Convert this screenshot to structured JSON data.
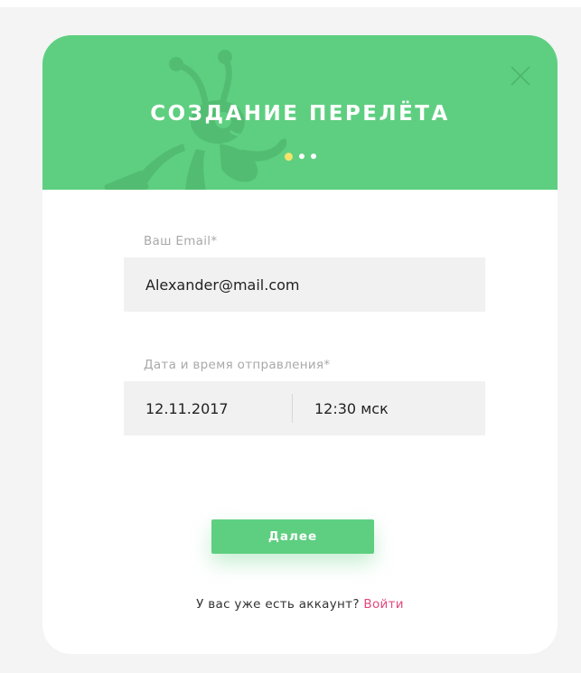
{
  "header": {
    "title": "СОЗДАНИЕ ПЕРЕЛЁТА",
    "close_icon": "close-icon",
    "mascot_icon": "ant-mascot",
    "step_indicator": {
      "current": 1,
      "total": 3
    }
  },
  "form": {
    "email": {
      "label": "Ваш Email*",
      "value": "Alexander@mail.com"
    },
    "departure": {
      "label": "Дата и время отправления*",
      "date_value": "12.11.2017",
      "time_value": "12:30 мск"
    },
    "next_label": "Далее"
  },
  "footer": {
    "question": "У вас уже есть аккаунт? ",
    "login_label": "Войти"
  },
  "colors": {
    "brand_green": "#5ecf80",
    "active_dot": "#f5e36b",
    "link_pink": "#e4477b",
    "field_bg": "#f1f1f1"
  }
}
